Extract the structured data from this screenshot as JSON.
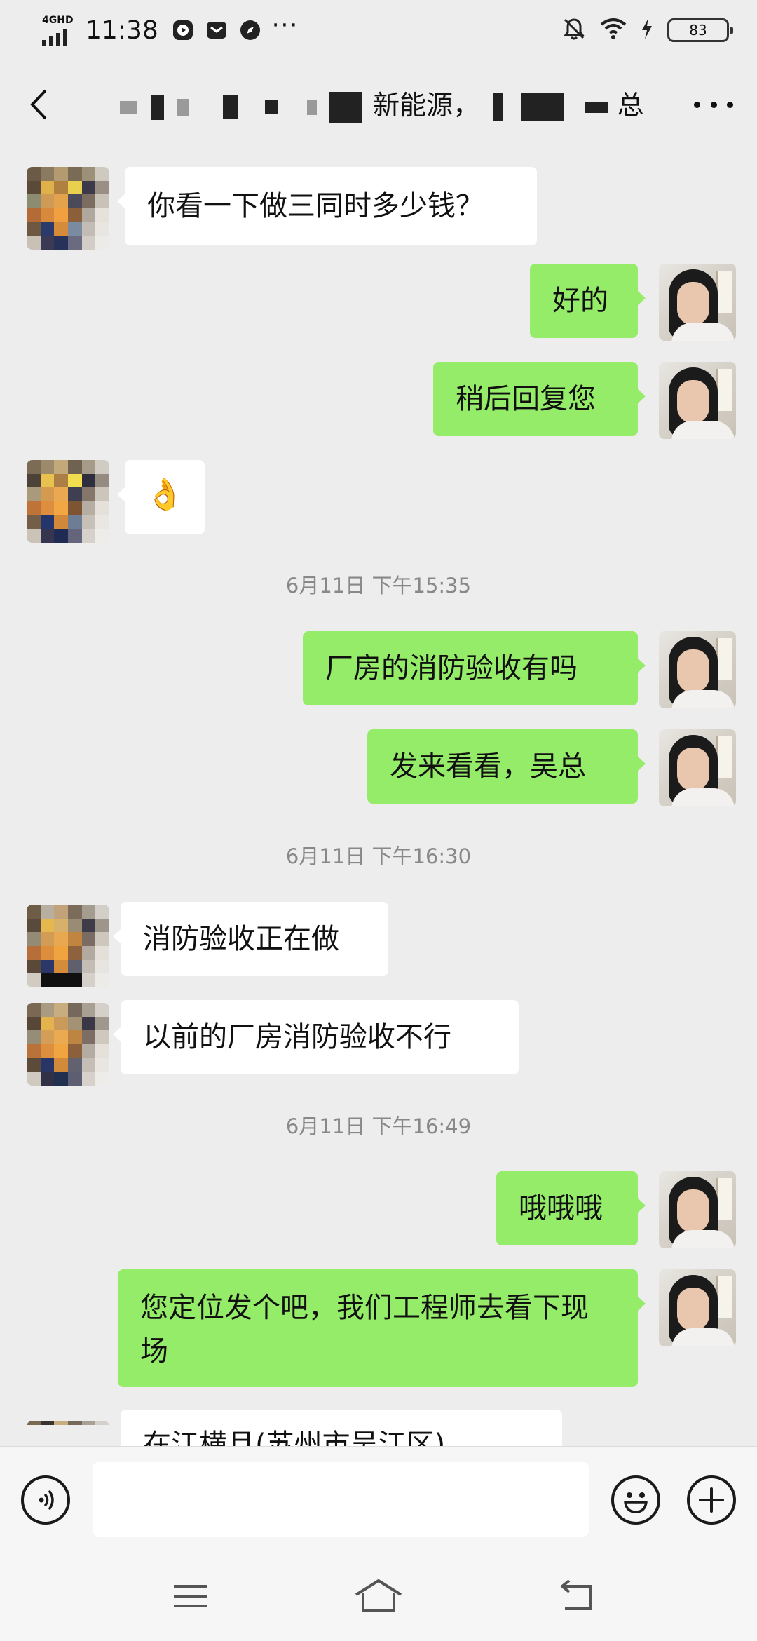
{
  "status_bar": {
    "network": "4GHD",
    "time": "11:38",
    "more": "···",
    "battery": "83",
    "icons": [
      "video-icon",
      "mail-icon",
      "compass-icon",
      "bell-off-icon",
      "wifi-icon",
      "charging-icon"
    ]
  },
  "header": {
    "title_visible_text": "新能源，",
    "title_tail": "总"
  },
  "messages": [
    {
      "side": "in",
      "text": "你看一下做三同时多少钱？"
    },
    {
      "side": "out",
      "text": "好的"
    },
    {
      "side": "out",
      "text": "稍后回复您"
    },
    {
      "side": "in",
      "text": "👌"
    },
    {
      "type": "time",
      "text": "6月11日 下午15:35"
    },
    {
      "side": "out",
      "text": "厂房的消防验收有吗"
    },
    {
      "side": "out",
      "text": "发来看看，吴总"
    },
    {
      "type": "time",
      "text": "6月11日 下午16:30"
    },
    {
      "side": "in",
      "text": "消防验收正在做"
    },
    {
      "side": "in",
      "text": "以前的厂房消防验收不行"
    },
    {
      "type": "time",
      "text": "6月11日 下午16:49"
    },
    {
      "side": "out",
      "text": "哦哦哦"
    },
    {
      "side": "out",
      "text": "您定位发个吧，我们工程师去看下现场"
    },
    {
      "side": "in",
      "text": "在江横且(苏州市吴江区)"
    }
  ],
  "input_bar": {
    "icons": [
      "voice-icon",
      "emoji-icon",
      "plus-icon"
    ]
  },
  "system_nav": {
    "icons": [
      "menu-icon",
      "home-icon",
      "back-nav-icon"
    ]
  }
}
